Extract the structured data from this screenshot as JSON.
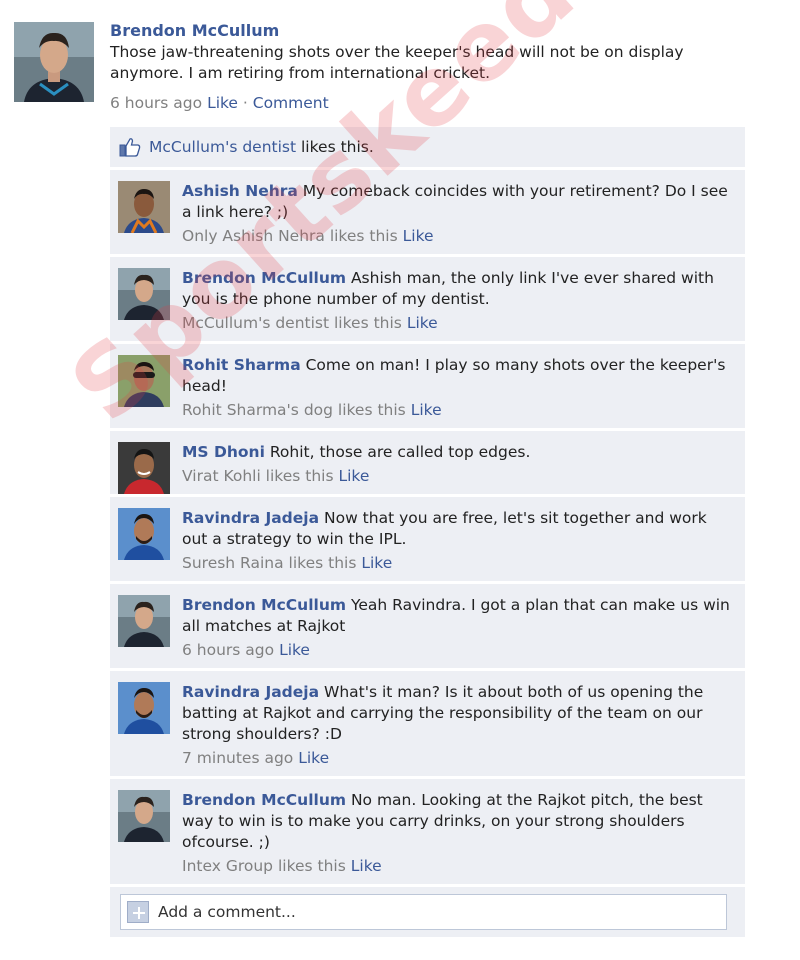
{
  "post": {
    "author": "Brendon McCullum",
    "text": "Those jaw-threatening shots over the keeper's head will not be on display anymore. I am retiring from international cricket.",
    "time": "6 hours ago",
    "like_label": "Like",
    "separator": " · ",
    "comment_label": "Comment"
  },
  "likes_bar": {
    "link": "McCullum's dentist",
    "suffix": " likes this."
  },
  "comments": [
    {
      "author": "Ashish Nehra",
      "text": "My comeback coincides with your retirement? Do I see a link here? ;)",
      "meta": "Only Ashish Nehra likes this",
      "like": "Like"
    },
    {
      "author": "Brendon McCullum",
      "text": "Ashish man, the only link I've ever shared with you is the phone number of my dentist.",
      "meta": "McCullum's dentist likes this",
      "like": "Like"
    },
    {
      "author": "Rohit Sharma",
      "text": "Come on man! I play so many shots over the keeper's head!",
      "meta": "Rohit Sharma's dog likes this",
      "like": "Like"
    },
    {
      "author": "MS Dhoni",
      "text": "Rohit, those are called top edges.",
      "meta": "Virat Kohli likes this",
      "like": "Like"
    },
    {
      "author": "Ravindra Jadeja",
      "text": "Now that you are free, let's sit together and work out a strategy to win the IPL.",
      "meta": "Suresh Raina likes this",
      "like": "Like"
    },
    {
      "author": "Brendon McCullum",
      "text": "Yeah Ravindra. I got a plan that can make us win all matches at Rajkot",
      "meta": "6 hours ago",
      "like": "Like"
    },
    {
      "author": "Ravindra Jadeja",
      "text": "What's it man? Is it about both of us opening the batting at Rajkot and carrying the responsibility of the team on our strong shoulders? :D",
      "meta": "7 minutes ago",
      "like": "Like"
    },
    {
      "author": "Brendon McCullum",
      "text": "No man. Looking at the Rajkot pitch, the best way to win is to make you carry drinks, on your strong shoulders ofcourse. ;)",
      "meta": "Intex Group likes this",
      "like": "Like"
    }
  ],
  "add_comment": {
    "placeholder": "Add a comment..."
  },
  "watermark": "Sportskeeda",
  "colors": {
    "link": "#3b5998",
    "comment_bg": "#edeff4",
    "meta": "#808080",
    "watermark": "#e43c46"
  }
}
